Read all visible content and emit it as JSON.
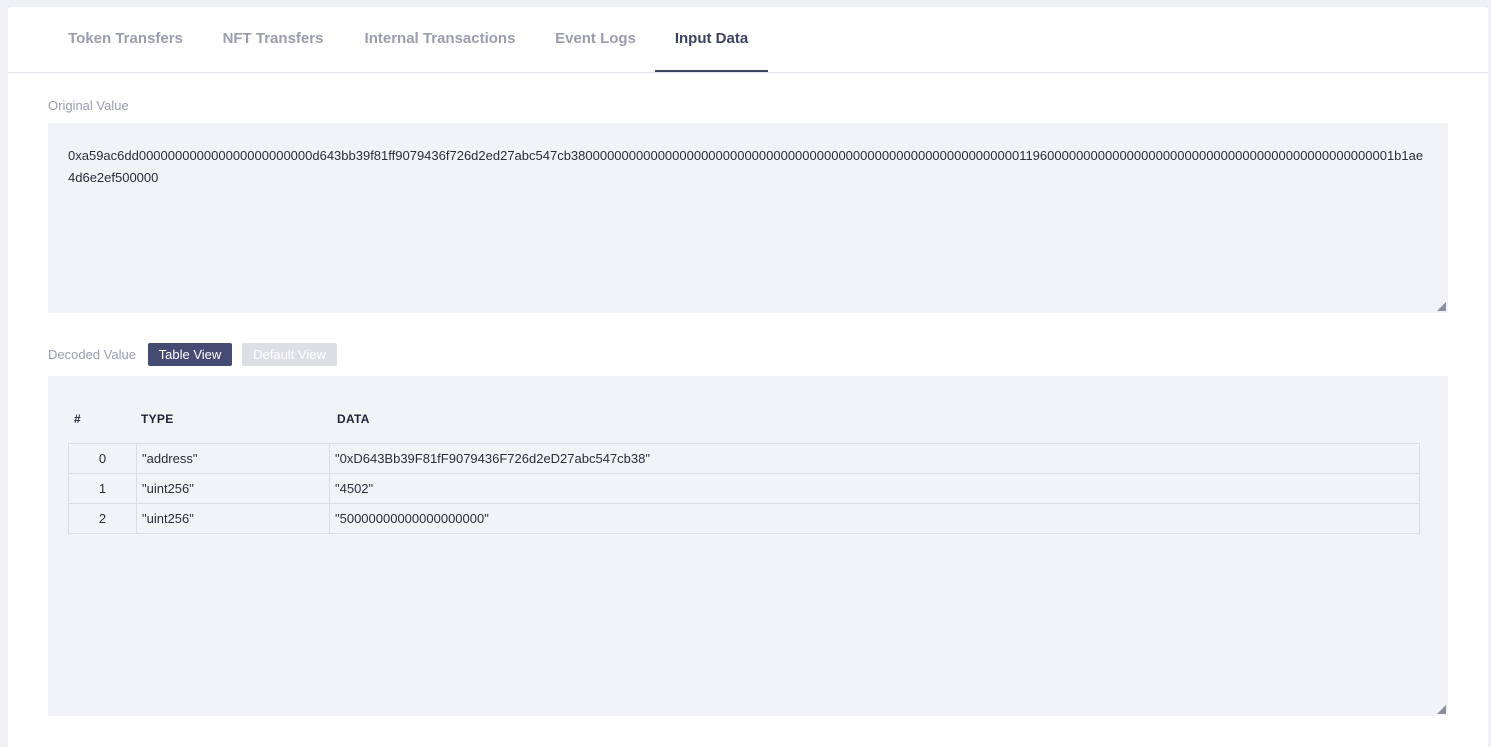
{
  "tabs": [
    {
      "label": "Token Transfers"
    },
    {
      "label": "NFT Transfers"
    },
    {
      "label": "Internal Transactions"
    },
    {
      "label": "Event Logs"
    },
    {
      "label": "Input Data"
    }
  ],
  "active_tab": "Input Data",
  "original": {
    "label": "Original Value",
    "value": "0xa59ac6dd000000000000000000000000d643bb39f81ff9079436f726d2ed27abc547cb380000000000000000000000000000000000000000000000000000000000001196000000000000000000000000000000000000000000000001b1ae4d6e2ef500000"
  },
  "decoded": {
    "label": "Decoded Value",
    "table_view": "Table View",
    "default_view": "Default View",
    "columns": [
      "#",
      "TYPE",
      "DATA"
    ],
    "rows": [
      {
        "index": "0",
        "type": "\"address\"",
        "data": "\"0xD643Bb39F81fF9079436F726d2eD27abc547cb38\""
      },
      {
        "index": "1",
        "type": "\"uint256\"",
        "data": "\"4502\""
      },
      {
        "index": "2",
        "type": "\"uint256\"",
        "data": "\"50000000000000000000\""
      }
    ]
  },
  "colors": {
    "accent": "#464b73",
    "active_tab": "#3e4261",
    "muted_text": "#9b9dae",
    "box_bg": "#f2f3f7"
  },
  "icons": [
    "resize-handle-icon"
  ]
}
